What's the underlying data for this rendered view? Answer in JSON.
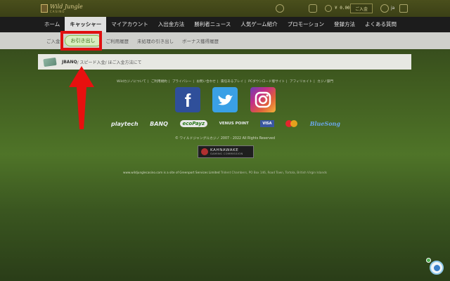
{
  "header": {
    "logo_text": "Wild Jungle",
    "logo_sub": "CASINO",
    "balance": "¥ 0.00",
    "login_label": "ご入金",
    "lang_label": "ja"
  },
  "nav": {
    "items": [
      {
        "label": "ホーム"
      },
      {
        "label": "キャッシャー"
      },
      {
        "label": "マイアカウント"
      },
      {
        "label": "入出金方法"
      },
      {
        "label": "勝利者ニュース"
      },
      {
        "label": "人気ゲーム紹介"
      },
      {
        "label": "プロモーション"
      },
      {
        "label": "登録方法"
      },
      {
        "label": "よくある質問"
      }
    ],
    "active_index": 1
  },
  "subnav": {
    "items": [
      {
        "label": "ご入金"
      },
      {
        "label": "お引き出し"
      },
      {
        "label": "ご利用履歴"
      },
      {
        "label": "未処理の引き出し"
      },
      {
        "label": "ボーナス獲得履歴"
      }
    ],
    "active_index": 1
  },
  "breadcrumb": {
    "part1": "JBANQ",
    "part2": "/ スピード入金",
    "part3": "/ ほご入金方法にて"
  },
  "footer": {
    "links": [
      "Wildカジノについて",
      "ご利用規約",
      "プライバシー",
      "お問い合わせ",
      "責任あるプレイ",
      "PCダウンロード版サイト",
      "アフィリエイト",
      "カジノ部門"
    ],
    "payments": [
      "playtech",
      "BANQ",
      "ecoPayz",
      "VENUS POINT",
      "VISA",
      "BlueSong"
    ],
    "copyright": "© ワイルドジャングルカジノ 2007 - 2022 All Rights Reserved",
    "kahnawake_title": "KAHNAWAKE",
    "kahnawake_sub": "GAMING COMMISSION",
    "site_line": "www.wildjunglecasino.com is a site of Greenport Services Limited",
    "site_address": "Trident Chambers, PO Box 146, Road Town, Tortola, British Virgin Islands"
  },
  "colors": {
    "highlight": "#e01010",
    "active_sub": "#d8eec0",
    "nav_bg": "#1c1c1c"
  }
}
